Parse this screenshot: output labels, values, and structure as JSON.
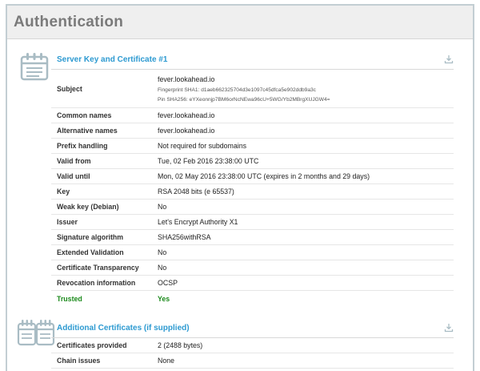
{
  "header": {
    "title": "Authentication"
  },
  "section1": {
    "title": "Server Key and Certificate #1",
    "icon": "certificate-icon",
    "download_icon": "download-icon",
    "subject": {
      "label": "Subject",
      "name": "fever.lookahead.io",
      "fingerprint": "Fingerprint SHA1: d1aeb662325704d3e1097c45dfca5e902ddb9a3c",
      "pin": "Pin SHA256: eYXeonnjp7BM6orNcNEwa96cU+5WG/Yb2MBrgXUJGW4="
    },
    "rows": [
      {
        "label": "Common names",
        "value": "fever.lookahead.io"
      },
      {
        "label": "Alternative names",
        "value": "fever.lookahead.io"
      },
      {
        "label": "Prefix handling",
        "value": "Not required for subdomains"
      },
      {
        "label": "Valid from",
        "value": "Tue, 02 Feb 2016 23:38:00 UTC"
      },
      {
        "label": "Valid until",
        "value": "Mon, 02 May 2016 23:38:00 UTC (expires in 2 months and 29 days)"
      },
      {
        "label": "Key",
        "value": "RSA 2048 bits (e 65537)"
      },
      {
        "label": "Weak key (Debian)",
        "value": "No"
      },
      {
        "label": "Issuer",
        "value": "Let's Encrypt Authority X1"
      },
      {
        "label": "Signature algorithm",
        "value": "SHA256withRSA"
      },
      {
        "label": "Extended Validation",
        "value": "No"
      },
      {
        "label": "Certificate Transparency",
        "value": "No"
      },
      {
        "label": "Revocation information",
        "value": "OCSP"
      },
      {
        "label": "Trusted",
        "value": "Yes"
      }
    ]
  },
  "section2": {
    "title": "Additional Certificates (if supplied)",
    "icon": "certificates-stack-icon",
    "download_icon": "download-icon",
    "rows": [
      {
        "label": "Certificates provided",
        "value": "2 (2488 bytes)"
      },
      {
        "label": "Chain issues",
        "value": "None"
      }
    ]
  },
  "colors": {
    "accent": "#2d9ad1",
    "trusted": "#1b8a1b",
    "icon": "#a9bcc4"
  }
}
